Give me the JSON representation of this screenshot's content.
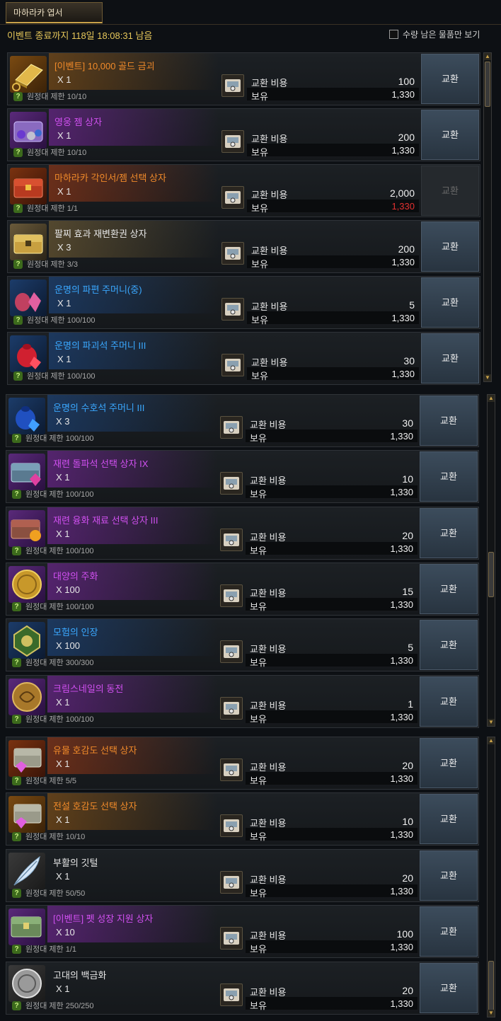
{
  "tab": {
    "label": "마하라카 엽서"
  },
  "timer": {
    "text": "이벤트 종료까지 118일 18:08:31 남음"
  },
  "filter": {
    "label": "수량 남은 물품만 보기",
    "checked": false
  },
  "labels": {
    "cost": "교환 비용",
    "own": "보유",
    "exchange": "교환"
  },
  "rows": [
    {
      "name": "[이벤트] 10,000 골드 금괴",
      "color": "orange",
      "grade": "legend",
      "icon": "gold-bar-icon",
      "qty": "X 1",
      "limit": "원정대 제한 10/10",
      "cost": "100",
      "own": "1,330",
      "own_short": false,
      "disabled": false
    },
    {
      "name": "영웅 젬 상자",
      "color": "purple",
      "grade": "epic",
      "icon": "gem-chest-icon",
      "qty": "X 1",
      "limit": "원정대 제한 10/10",
      "cost": "200",
      "own": "1,330",
      "own_short": false,
      "disabled": false
    },
    {
      "name": "마하라카 각인서/젬 선택 상자",
      "color": "orange",
      "grade": "relic",
      "icon": "red-chest-icon",
      "qty": "X 1",
      "limit": "원정대 제한 1/1",
      "cost": "2,000",
      "own": "1,330",
      "own_short": true,
      "disabled": true
    },
    {
      "name": "팔찌 효과 재변환권 상자",
      "color": "white",
      "grade": "ancient",
      "icon": "gold-chest-icon",
      "qty": "X 3",
      "limit": "원정대 제한 3/3",
      "cost": "200",
      "own": "1,330",
      "own_short": false,
      "disabled": false
    },
    {
      "name": "운명의 파편 주머니(중)",
      "color": "blue",
      "grade": "rare",
      "icon": "shard-pouch-icon",
      "qty": "X 1",
      "limit": "원정대 제한 100/100",
      "cost": "5",
      "own": "1,330",
      "own_short": false,
      "disabled": false
    },
    {
      "name": "운명의 파괴석 주머니 III",
      "color": "blue",
      "grade": "rare",
      "icon": "red-pouch-icon",
      "qty": "X 1",
      "limit": "원정대 제한 100/100",
      "cost": "30",
      "own": "1,330",
      "own_short": false,
      "disabled": false
    },
    {
      "name": "운명의 수호석 주머니 III",
      "color": "blue",
      "grade": "rare",
      "icon": "blue-pouch-icon",
      "qty": "X 3",
      "limit": "원정대 제한 100/100",
      "cost": "30",
      "own": "1,330",
      "own_short": false,
      "disabled": false
    },
    {
      "name": "재련 돌파석 선택 상자 IX",
      "color": "purple",
      "grade": "epic",
      "icon": "crystal-chest-icon",
      "qty": "X 1",
      "limit": "원정대 제한 100/100",
      "cost": "10",
      "own": "1,330",
      "own_short": false,
      "disabled": false
    },
    {
      "name": "재련 융화 재료 선택 상자 III",
      "color": "purple",
      "grade": "epic",
      "icon": "orange-gem-chest-icon",
      "qty": "X 1",
      "limit": "원정대 제한 100/100",
      "cost": "20",
      "own": "1,330",
      "own_short": false,
      "disabled": false
    },
    {
      "name": "대양의 주화",
      "color": "purple",
      "grade": "epic",
      "icon": "gold-coin-icon",
      "qty": "X 100",
      "limit": "원정대 제한 100/100",
      "cost": "15",
      "own": "1,330",
      "own_short": false,
      "disabled": false
    },
    {
      "name": "모험의 인장",
      "color": "blue",
      "grade": "rare",
      "icon": "seal-icon",
      "qty": "X 100",
      "limit": "원정대 제한 300/300",
      "cost": "5",
      "own": "1,330",
      "own_short": false,
      "disabled": false
    },
    {
      "name": "크림스네일의 동전",
      "color": "purple",
      "grade": "epic",
      "icon": "bronze-coin-icon",
      "qty": "X 1",
      "limit": "원정대 제한 100/100",
      "cost": "1",
      "own": "1,330",
      "own_short": false,
      "disabled": false
    },
    {
      "name": "유물 호감도 선택 상자",
      "color": "orange",
      "grade": "relic",
      "icon": "silver-chest-icon",
      "qty": "X 1",
      "limit": "원정대 제한 5/5",
      "cost": "20",
      "own": "1,330",
      "own_short": false,
      "disabled": false
    },
    {
      "name": "전설 호감도 선택 상자",
      "color": "orange",
      "grade": "legend",
      "icon": "silver-chest-icon",
      "qty": "X 1",
      "limit": "원정대 제한 10/10",
      "cost": "10",
      "own": "1,330",
      "own_short": false,
      "disabled": false
    },
    {
      "name": "부활의 깃털",
      "color": "white",
      "grade": "normal",
      "icon": "feather-icon",
      "qty": "X 1",
      "limit": "원정대 제한 50/50",
      "cost": "20",
      "own": "1,330",
      "own_short": false,
      "disabled": false
    },
    {
      "name": "[이벤트] 펫 성장 지원 상자",
      "color": "purple",
      "grade": "epic",
      "icon": "green-chest-icon",
      "qty": "X 10",
      "limit": "원정대 제한 1/1",
      "cost": "100",
      "own": "1,330",
      "own_short": false,
      "disabled": false
    },
    {
      "name": "고대의 백금화",
      "color": "white",
      "grade": "normal",
      "icon": "silver-coin-icon",
      "qty": "X 1",
      "limit": "원정대 제한 250/250",
      "cost": "20",
      "own": "1,330",
      "own_short": false,
      "disabled": false
    }
  ]
}
